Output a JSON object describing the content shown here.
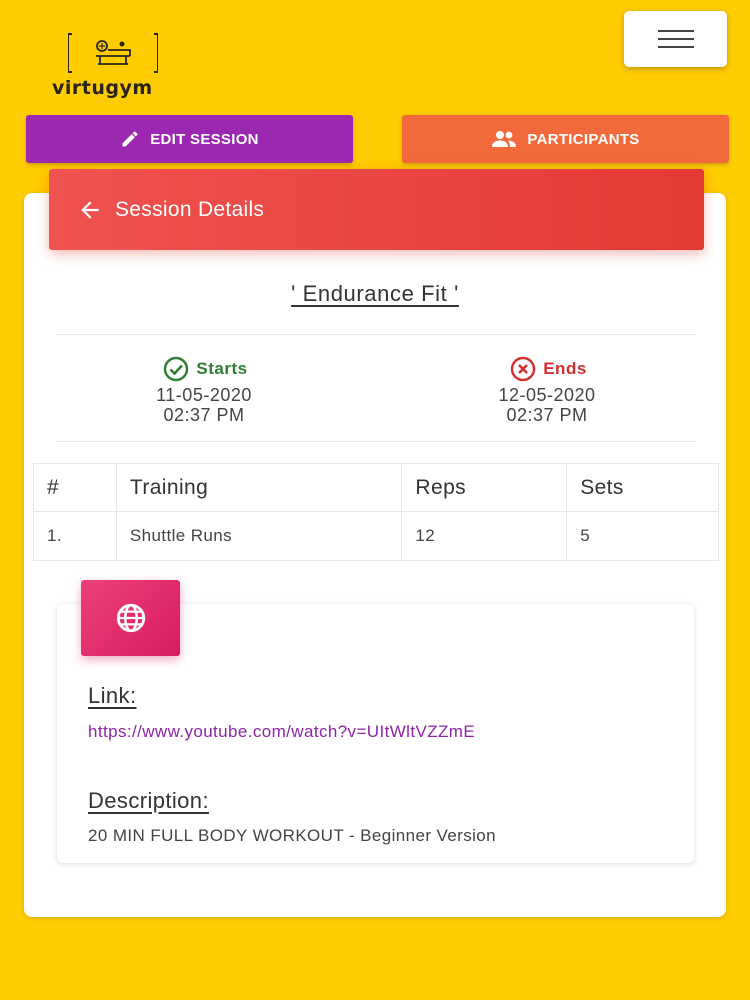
{
  "brand": {
    "name": "virtugym"
  },
  "toolbar": {
    "edit_label": "EDIT SESSION",
    "participants_label": "PARTICIPANTS"
  },
  "header": {
    "title": "Session Details"
  },
  "session": {
    "title": "' Endurance Fit '",
    "starts_label": "Starts",
    "starts_date": "11-05-2020",
    "starts_time": "02:37 PM",
    "ends_label": "Ends",
    "ends_date": "12-05-2020",
    "ends_time": "02:37 PM"
  },
  "table": {
    "headers": [
      "#",
      "Training",
      "Reps",
      "Sets"
    ],
    "rows": [
      [
        "1.",
        "Shuttle Runs",
        "12",
        "5"
      ]
    ]
  },
  "resource": {
    "link_label": "Link:",
    "link_url": "https://www.youtube.com/watch?v=UItWltVZZmE",
    "description_label": "Description:",
    "description": "20 MIN FULL BODY WORKOUT - Beginner Version"
  },
  "icons": {
    "menu": "hamburger-icon",
    "edit": "pencil-icon",
    "participants": "people-icon",
    "back": "arrow-left-icon",
    "starts": "check-circle-icon",
    "ends": "x-circle-icon",
    "resource": "globe-icon"
  },
  "colors": {
    "background": "#FFCC00",
    "edit_button": "#9C27B0",
    "participants_button": "#F2693C",
    "header": "#E53935",
    "starts": "#2E7D32",
    "ends": "#D32F2F",
    "globe_box": "#D81B60",
    "link": "#8E24AA"
  }
}
